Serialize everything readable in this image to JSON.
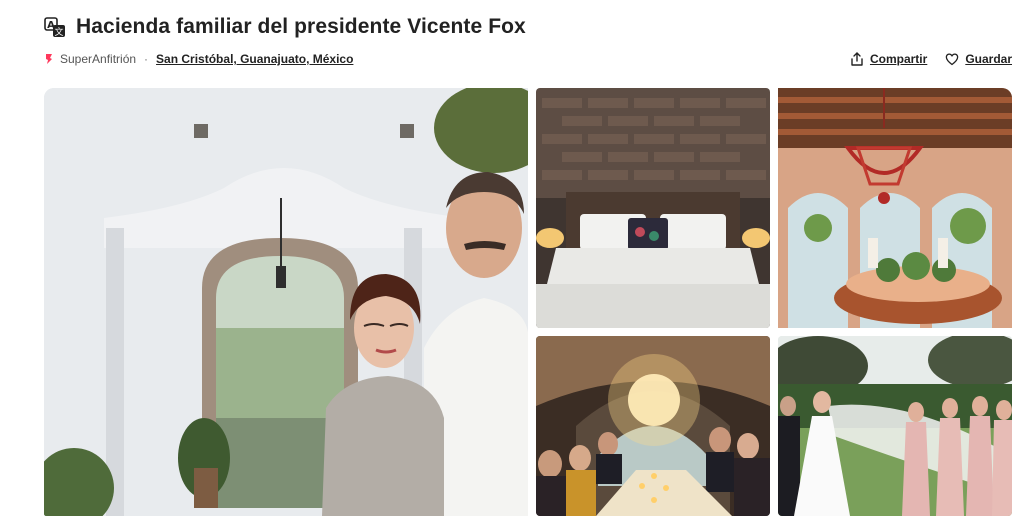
{
  "listing": {
    "title": "Hacienda familiar del presidente Vicente Fox",
    "superhost_label": "SuperAnfitrión",
    "separator": "·",
    "location": "San Cristóbal, Guanajuato, México"
  },
  "actions": {
    "share_label": "Compartir",
    "save_label": "Guardar"
  },
  "icons": {
    "translate": "translate-icon",
    "superhost": "superhost-badge-icon",
    "share": "share-icon",
    "save": "heart-icon"
  },
  "colors": {
    "brand": "#ff385c",
    "text": "#222222",
    "muted": "#717171"
  }
}
